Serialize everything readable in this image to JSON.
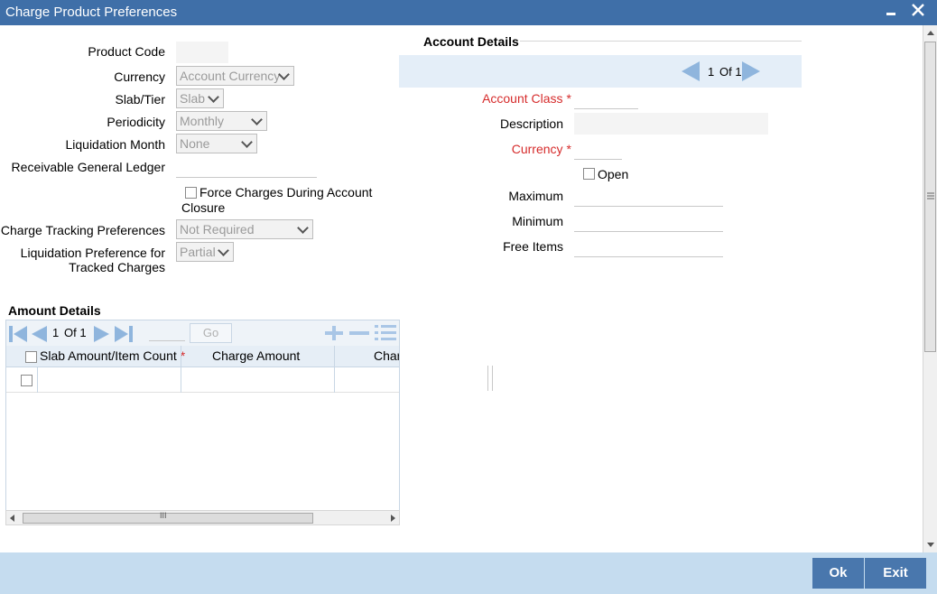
{
  "window": {
    "title": "Charge Product Preferences"
  },
  "form": {
    "product_code_label": "Product Code",
    "currency_label": "Currency",
    "currency_value": "Account Currency",
    "slab_label": "Slab/Tier",
    "slab_value": "Slab",
    "periodicity_label": "Periodicity",
    "periodicity_value": "Monthly",
    "liq_month_label": "Liquidation Month",
    "liq_month_value": "None",
    "recv_gl_label": "Receivable General Ledger",
    "force_charges_label_1": "Force Charges During Account",
    "force_charges_label_2": "Closure",
    "charge_tracking_label": "Charge Tracking Preferences",
    "charge_tracking_value": "Not Required",
    "liq_pref_label_1": "Liquidation Preference for",
    "liq_pref_label_2": "Tracked Charges",
    "liq_pref_value": "Partial"
  },
  "account": {
    "title": "Account Details",
    "page_current": "1",
    "page_of": "Of 1",
    "account_class_label": "Account Class",
    "description_label": "Description",
    "currency_label": "Currency",
    "open_label": "Open",
    "maximum_label": "Maximum",
    "minimum_label": "Minimum",
    "free_items_label": "Free Items",
    "required_mark": "*"
  },
  "amount": {
    "title": "Amount Details",
    "page_current": "1",
    "page_of": "Of 1",
    "go_label": "Go",
    "columns": [
      "Slab Amount/Item Count",
      "Charge Amount",
      "Char"
    ],
    "required_mark": "*"
  },
  "scroll": {
    "h_thumb_grip": "III"
  },
  "footer": {
    "ok_label": "Ok",
    "exit_label": "Exit"
  },
  "colors": {
    "titlebar": "#3f6fa8",
    "required": "#d62c2c",
    "footer": "#c5dcef",
    "button": "#4977ad"
  }
}
